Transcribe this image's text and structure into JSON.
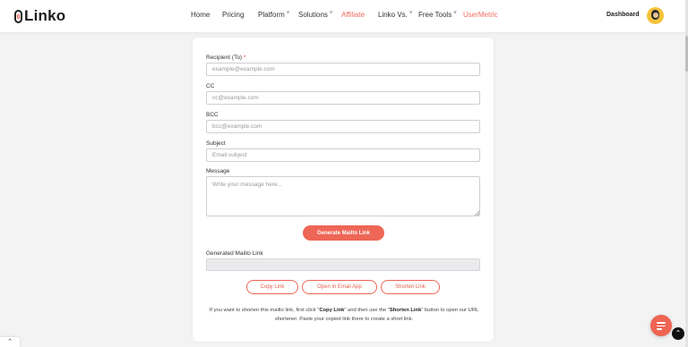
{
  "header": {
    "logo_text": "Linko",
    "nav": [
      {
        "label": "Home",
        "dropdown": false
      },
      {
        "label": "Pricing",
        "dropdown": false
      },
      {
        "label": "Platform",
        "dropdown": true
      },
      {
        "label": "Solutions",
        "dropdown": true
      },
      {
        "label": "Affiliate",
        "dropdown": false,
        "accent": true
      },
      {
        "label": "Linko Vs.",
        "dropdown": true
      },
      {
        "label": "Free Tools",
        "dropdown": true
      },
      {
        "label": "UserMetric",
        "dropdown": false,
        "accent": true
      }
    ],
    "dashboard_label": "Dashboard"
  },
  "form": {
    "recipient": {
      "label": "Recipient (To)",
      "required_mark": "*",
      "value": "",
      "placeholder": "example@example.com"
    },
    "cc": {
      "label": "CC",
      "value": "",
      "placeholder": "cc@example.com"
    },
    "bcc": {
      "label": "BCC",
      "value": "",
      "placeholder": "bcc@example.com"
    },
    "subject": {
      "label": "Subject",
      "value": "",
      "placeholder": "Email subject"
    },
    "message": {
      "label": "Message",
      "value": "",
      "placeholder": "Write your message here..."
    },
    "generate_label": "Generate Mailto Link",
    "output_label": "Generated Mailto Link",
    "output_value": "",
    "copy_label": "Copy Link",
    "open_label": "Open in Email App",
    "shorten_label": "Shorten Link",
    "help": {
      "t1": "If you want to shorten this mailto link, first click \"",
      "b1": "Copy Link",
      "t2": "\" and then use the \"",
      "b2": "Shorten Link",
      "t3": "\" button to open our URL shortener. Paste your copied link there to create a short link."
    }
  },
  "colors": {
    "accent": "#ee6656",
    "background": "#f3f3f4",
    "card": "#ffffff"
  },
  "icons": {
    "menu": "hamburger-icon",
    "scroll_top": "chevron-up-icon",
    "collapse": "chevron-up-icon"
  }
}
